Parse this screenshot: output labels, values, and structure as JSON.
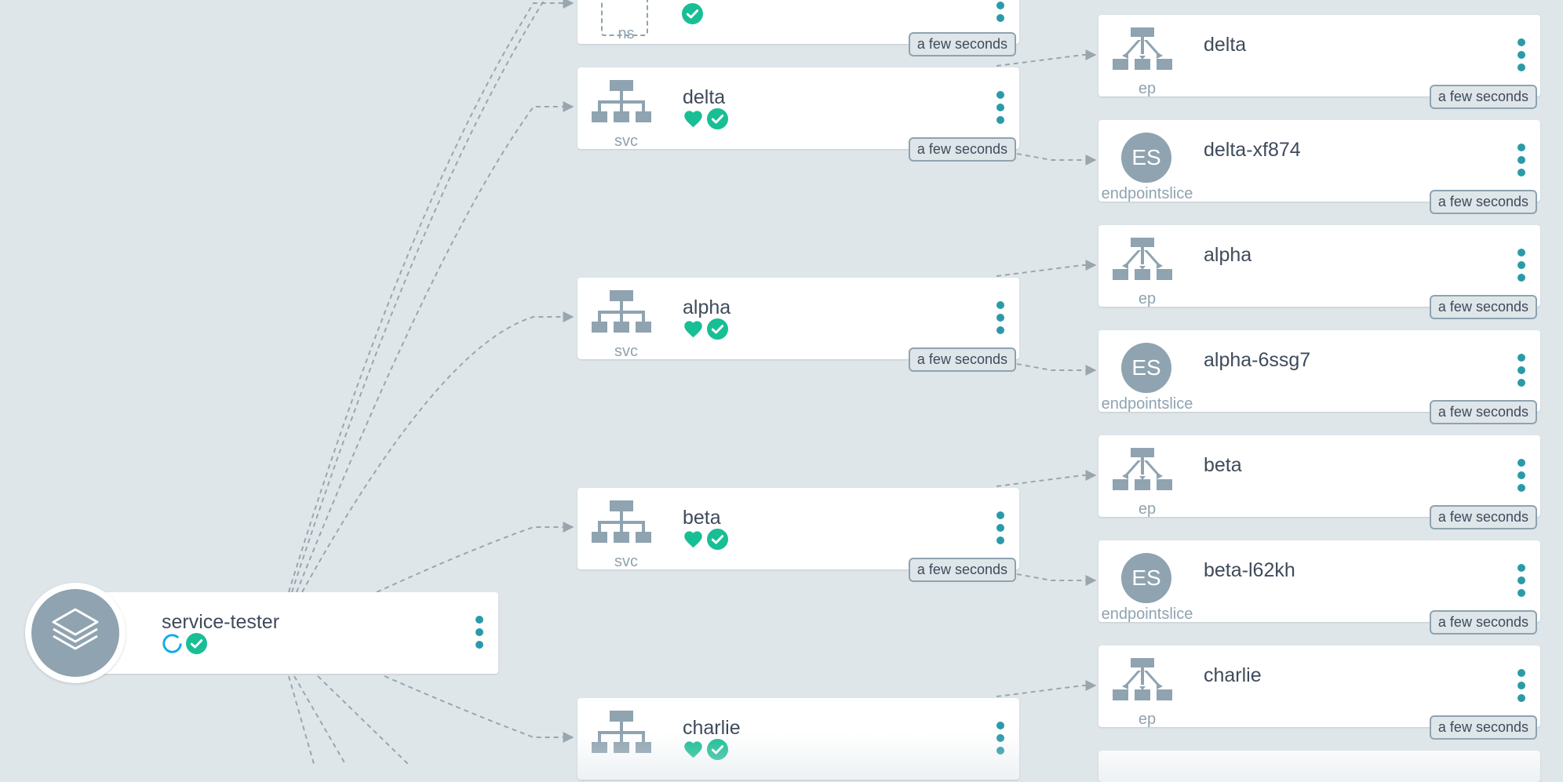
{
  "graph": {
    "app": {
      "name": "service-tester"
    },
    "ns_node": {
      "kind": "ns"
    },
    "services": [
      {
        "name": "delta",
        "kind": "svc",
        "age": "a few seconds"
      },
      {
        "name": "alpha",
        "kind": "svc",
        "age": "a few seconds"
      },
      {
        "name": "beta",
        "kind": "svc",
        "age": "a few seconds"
      },
      {
        "name": "charlie",
        "kind": "svc"
      }
    ],
    "ns_age": "a few seconds",
    "children": [
      {
        "name": "delta",
        "kind": "ep",
        "age": "a few seconds"
      },
      {
        "name": "delta-xf874",
        "kind": "endpointslice",
        "icon_text": "ES",
        "age": "a few seconds"
      },
      {
        "name": "alpha",
        "kind": "ep",
        "age": "a few seconds"
      },
      {
        "name": "alpha-6ssg7",
        "kind": "endpointslice",
        "icon_text": "ES",
        "age": "a few seconds"
      },
      {
        "name": "beta",
        "kind": "ep",
        "age": "a few seconds"
      },
      {
        "name": "beta-l62kh",
        "kind": "endpointslice",
        "icon_text": "ES",
        "age": "a few seconds"
      },
      {
        "name": "charlie",
        "kind": "ep",
        "age": "a few seconds"
      }
    ]
  },
  "icons": {
    "service": "service-network-icon",
    "endpoints": "endpoints-network-icon",
    "app": "layers-icon",
    "healthy": "heart-icon",
    "synced": "check-circle-icon",
    "progressing": "progressing-ring-icon",
    "menu": "kebab-menu-icon"
  },
  "colors": {
    "background": "#dee6ea",
    "healthy": "#18be94",
    "menu": "#2b9aa8",
    "icon_gray": "#8fa3b0",
    "progressing": "#0dadea"
  }
}
